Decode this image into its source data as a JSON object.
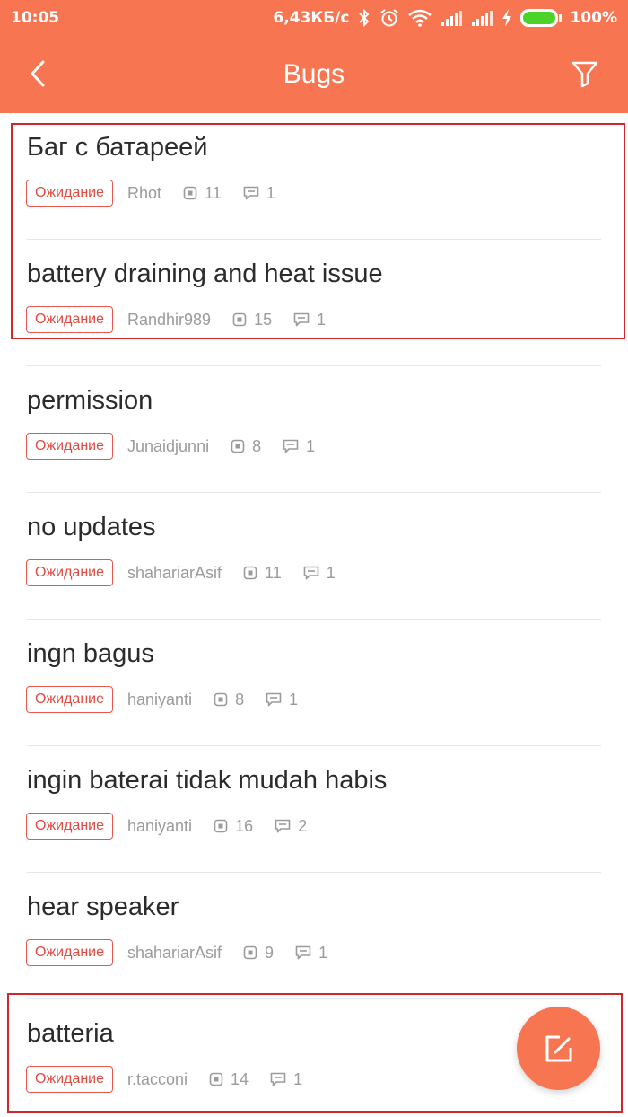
{
  "status_bar": {
    "time": "10:05",
    "speed": "6,43КБ/с",
    "battery": "100%",
    "icons": [
      "bluetooth-icon",
      "alarm-icon",
      "wifi-icon",
      "signal-icon",
      "signal-icon",
      "charging-icon",
      "battery-icon"
    ]
  },
  "header": {
    "title": "Bugs",
    "back_icon": "back-arrow-icon",
    "filter_icon": "filter-icon"
  },
  "colors": {
    "accent": "#f87551",
    "badge": "#e34a41",
    "highlight": "#d0262c"
  },
  "bugs": [
    {
      "title": "Баг с батареей",
      "status": "Ожидание",
      "author": "Rhot",
      "votes": "11",
      "comments": "1"
    },
    {
      "title": "battery draining and heat issue",
      "status": "Ожидание",
      "author": "Randhir989",
      "votes": "15",
      "comments": "1"
    },
    {
      "title": "permission",
      "status": "Ожидание",
      "author": "Junaidjunni",
      "votes": "8",
      "comments": "1"
    },
    {
      "title": "no updates",
      "status": "Ожидание",
      "author": "shahariarAsif",
      "votes": "11",
      "comments": "1"
    },
    {
      "title": "ingn bagus",
      "status": "Ожидание",
      "author": "haniyanti",
      "votes": "8",
      "comments": "1"
    },
    {
      "title": "ingin baterai tidak mudah habis",
      "status": "Ожидание",
      "author": "haniyanti",
      "votes": "16",
      "comments": "2"
    },
    {
      "title": "hear speaker",
      "status": "Ожидание",
      "author": "shahariarAsif",
      "votes": "9",
      "comments": "1"
    },
    {
      "title": "batteria",
      "status": "Ожидание",
      "author": "r.tacconi",
      "votes": "14",
      "comments": "1"
    }
  ],
  "fab": {
    "icon": "compose-icon"
  }
}
